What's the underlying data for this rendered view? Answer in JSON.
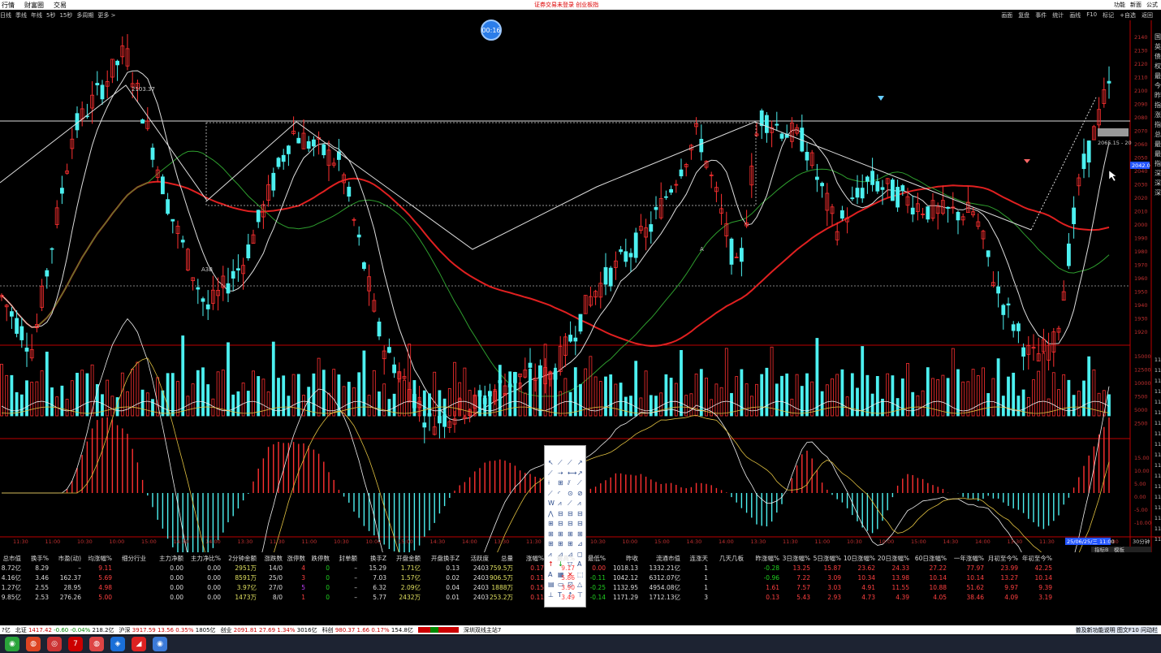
{
  "topbar": {
    "menu1": "行情",
    "menu2": "财富圈",
    "menu3": "交易",
    "center": "证券交易未登录   创业板指",
    "right": [
      "功能",
      "新面",
      "公式"
    ]
  },
  "toolbar": {
    "left": [
      "日线",
      "季线",
      "年线",
      "5秒",
      "15秒",
      "多周期",
      "更多 >"
    ],
    "right": [
      "画面",
      "复盘",
      "事件",
      "统计",
      "画线",
      "F10",
      "标记",
      "+自选",
      "返回"
    ]
  },
  "timer": "00:16",
  "chart_labels": {
    "high_label": "2103.37",
    "low_label_a": "A3B",
    "low_label_b": "A",
    "cur_label": "2065.15 - 20",
    "price_tag": "2042.0"
  },
  "price_axis": [
    "2140",
    "2130",
    "2120",
    "2110",
    "2100",
    "2090",
    "2080",
    "2070",
    "2060",
    "2050",
    "2040",
    "2030",
    "2020",
    "2010",
    "2000",
    "1990",
    "1980",
    "1970",
    "1960",
    "1950",
    "1940",
    "1930",
    "1920"
  ],
  "volume_axis": [
    "15000",
    "12500",
    "10000",
    "7500",
    "5000",
    "2500"
  ],
  "macd_axis": [
    "15.00",
    "10.00",
    "5.00",
    "0.00",
    "-5.00",
    "-10.00"
  ],
  "right_vertical": [
    "国",
    "英",
    "债",
    "权",
    "最",
    "今",
    "昨",
    "指",
    "涨",
    "指",
    "总",
    "最",
    "最",
    "指",
    "深",
    "深",
    "深"
  ],
  "time_axis": [
    "11:30",
    "11:00",
    "10:30",
    "10:00",
    "15:00",
    "14:30",
    "14:00",
    "13:30",
    "11:30",
    "11:00",
    "10:30",
    "10:00",
    "15:00",
    "14:30",
    "14:00",
    "13:30",
    "11:30",
    "11:00",
    "10:30",
    "10:00",
    "15:00",
    "14:30",
    "14:00",
    "13:30",
    "11:30",
    "11:00",
    "10:30",
    "10:00",
    "15:00",
    "14:30",
    "14:00",
    "13:30",
    "11:30",
    "11:00",
    "10:30"
  ],
  "time_highlight": "25/06/25/三 11:00",
  "period": "30分钟",
  "subtabs": {
    "zb": "指标B",
    "mb": "模板"
  },
  "table": {
    "headers": [
      "总市值",
      "换手%",
      "市盈(动)",
      "均涨幅%",
      "细分行业",
      "主力净额",
      "主力净比%",
      "2分钟金额",
      "涨跌数",
      "涨停数",
      "跌停数",
      "封单额",
      "换手Z",
      "开盘金额",
      "开盘换手Z",
      "活跃度",
      "总量",
      "涨幅%",
      "最高%",
      "最低%",
      "昨收",
      "流通市值",
      "连涨天",
      "几天几板",
      "昨涨幅%",
      "3日涨幅%",
      "5日涨幅%",
      "10日涨幅%",
      "20日涨幅%",
      "60日涨幅%",
      "一年涨幅%",
      "月初至今%",
      "年初至今%"
    ],
    "rows": [
      [
        "8.72亿",
        "8.29",
        "–",
        "9.11",
        "",
        "0.00",
        "0.00",
        "2951万",
        "14/0",
        "4",
        "0",
        "–",
        "15.29",
        "1.71亿",
        "0.13",
        "2403",
        "759.5万",
        "0.17",
        "9.17",
        "0.00",
        "1018.13",
        "1332.21亿",
        "1",
        "",
        "-0.28",
        "13.25",
        "15.87",
        "23.62",
        "24.33",
        "27.22",
        "77.97",
        "23.99",
        "42.25"
      ],
      [
        "4.16亿",
        "3.46",
        "162.37",
        "5.69",
        "",
        "0.00",
        "0.00",
        "8591万",
        "25/0",
        "3",
        "0",
        "–",
        "7.03",
        "1.57亿",
        "0.02",
        "2403",
        "906.5万",
        "0.11",
        "5.86",
        "-0.11",
        "1042.12",
        "6312.07亿",
        "1",
        "",
        "-0.96",
        "7.22",
        "3.09",
        "10.34",
        "13.98",
        "10.14",
        "10.14",
        "13.27",
        "10.14"
      ],
      [
        "1.27亿",
        "2.55",
        "28.95",
        "4.98",
        "",
        "0.00",
        "0.00",
        "3.97亿",
        "27/0",
        "5",
        "0",
        "–",
        "6.32",
        "2.09亿",
        "0.04",
        "2403",
        "1888万",
        "0.15",
        "3.90",
        "-0.25",
        "1132.95",
        "4954.08亿",
        "1",
        "",
        "1.61",
        "7.57",
        "3.03",
        "4.91",
        "11.55",
        "10.88",
        "51.62",
        "9.97",
        "9.39"
      ],
      [
        "9.85亿",
        "2.53",
        "276.26",
        "5.00",
        "",
        "0.00",
        "0.00",
        "1473万",
        "8/0",
        "1",
        "0",
        "–",
        "5.77",
        "2432万",
        "0.01",
        "2403",
        "253.2万",
        "0.11",
        "3.49",
        "-0.14",
        "1171.29",
        "1712.13亿",
        "3",
        "",
        "0.13",
        "5.43",
        "2.93",
        "4.73",
        "4.39",
        "4.05",
        "38.46",
        "4.09",
        "3.19"
      ]
    ]
  },
  "footer": {
    "left": "?亿",
    "bz_label": "北证",
    "bz_val": "1417.42",
    "bz_chg": "-0.60",
    "bz_pct": "-0.04%",
    "bz_amt": "218.2亿",
    "hs_label": "沪深",
    "hs_val": "3917.59",
    "hs_chg": "13.56",
    "hs_pct": "0.35%",
    "hs_amt": "1805亿",
    "cy_label": "创业",
    "cy_val": "2091.81",
    "cy_chg": "27.69",
    "cy_pct": "1.34%",
    "cy_amt": "3016亿",
    "kc_label": "科创",
    "kc_val": "980.37",
    "kc_chg": "1.66",
    "kc_pct": "0.17%",
    "kc_amt": "154.8亿",
    "mkt": "深圳双线主站7",
    "right": "普及新功能说明 图文F10 问动栏"
  },
  "taskbar": [
    "wechat",
    "app2",
    "app3",
    "app4",
    "app5",
    "app6",
    "app7",
    "app8"
  ]
}
